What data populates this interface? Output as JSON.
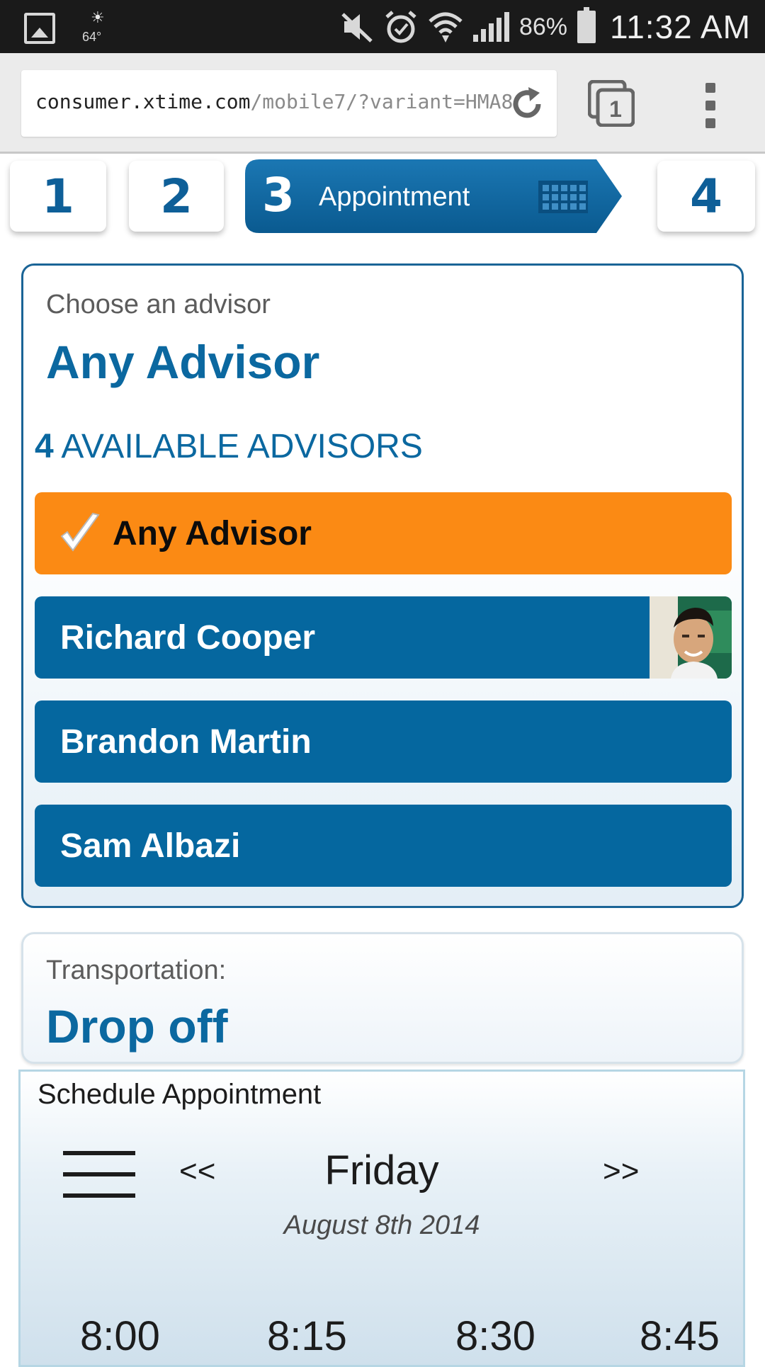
{
  "status_bar": {
    "weather_temp": "64°",
    "battery": "86%",
    "time": "11:32 AM",
    "icons": [
      "gallery-icon",
      "weather-icon",
      "mute-icon",
      "alarm-icon",
      "wifi-icon",
      "signal-icon",
      "battery-icon"
    ]
  },
  "browser": {
    "url_host": "consumer.xtime.com",
    "url_path": "/mobile7/?variant=HMA8",
    "tab_count": "1"
  },
  "steps": {
    "step1": "1",
    "step2": "2",
    "step3": "3",
    "step3_label": "Appointment",
    "step4": "4"
  },
  "advisor": {
    "label": "Choose an advisor",
    "selected": "Any Advisor",
    "available_count": "4",
    "available_text": "AVAILABLE ADVISORS",
    "options": [
      {
        "name": "Any Advisor",
        "selected": true
      },
      {
        "name": "Richard Cooper",
        "has_photo": true
      },
      {
        "name": "Brandon Martin"
      },
      {
        "name": "Sam Albazi"
      }
    ]
  },
  "transportation": {
    "label": "Transportation:",
    "value": "Drop off"
  },
  "schedule": {
    "title": "Schedule Appointment",
    "prev": "<<",
    "next": ">>",
    "day": "Friday",
    "date": "August 8th 2014",
    "slots": [
      "8:00",
      "8:15",
      "8:30",
      "8:45"
    ]
  },
  "colors": {
    "primary_blue": "#05679f",
    "selected_orange": "#fb8a14",
    "status_bar": "#1a1a1a"
  }
}
